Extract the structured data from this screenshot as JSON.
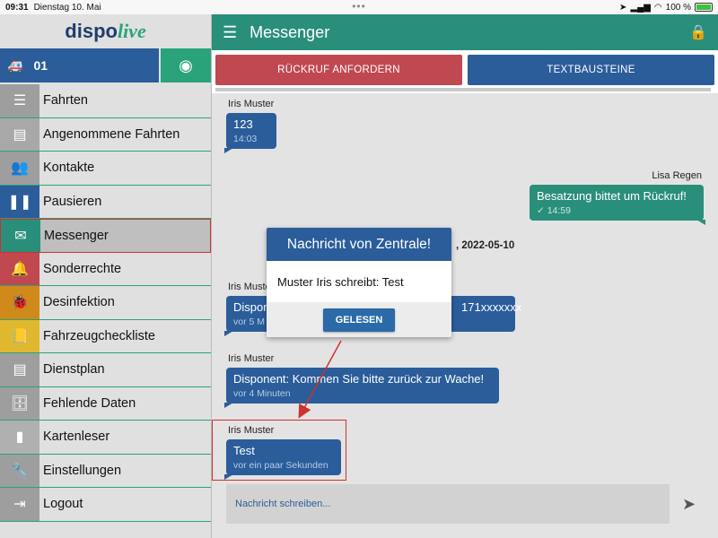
{
  "statusbar": {
    "time": "09:31",
    "date": "Dienstag 10. Mai",
    "battery": "100 %"
  },
  "sidebar": {
    "logo_a": "dispo",
    "logo_b": "live",
    "vehicle": "01",
    "items": [
      {
        "label": "Fahrten",
        "color": "#9e9e9e"
      },
      {
        "label": "Angenommene Fahrten",
        "color": "#a8a8a8"
      },
      {
        "label": "Kontakte",
        "color": "#9e9e9e"
      },
      {
        "label": "Pausieren",
        "color": "#2a5d9a"
      },
      {
        "label": "Messenger",
        "color": "#2a8f7a"
      },
      {
        "label": "Sonderrechte",
        "color": "#c04850"
      },
      {
        "label": "Desinfektion",
        "color": "#d08a1a"
      },
      {
        "label": "Fahrzeugcheckliste",
        "color": "#e0b830"
      },
      {
        "label": "Dienstplan",
        "color": "#9e9e9e"
      },
      {
        "label": "Fehlende Daten",
        "color": "#9e9e9e"
      },
      {
        "label": "Kartenleser",
        "color": "#b0b0b0"
      },
      {
        "label": "Einstellungen",
        "color": "#9e9e9e"
      },
      {
        "label": "Logout",
        "color": "#9e9e9e"
      }
    ]
  },
  "appbar": {
    "title": "Messenger"
  },
  "buttons": {
    "callback": "RÜCKRUF ANFORDERN",
    "templates": "TEXTBAUSTEINE"
  },
  "messages": [
    {
      "sender": "Iris Muster",
      "text": "123",
      "time": "14:03"
    },
    {
      "sender": "Lisa Regen",
      "text": "Besatzung bittet um Rückruf!",
      "time": "✓ 14:59"
    },
    {
      "date": ", 2022-05-10"
    },
    {
      "sender": "Iris Muster",
      "text": "Dispon",
      "text_end": "171xxxxxxx",
      "time": "vor 5 M"
    },
    {
      "sender": "Iris Muster",
      "text": "Disponent: Kommen Sie bitte zurück zur Wache!",
      "time": "vor 4 Minuten"
    },
    {
      "sender": "Iris Muster",
      "text": "Test",
      "time": "vor ein paar Sekunden"
    }
  ],
  "composer": {
    "placeholder": "Nachricht schreiben..."
  },
  "dialog": {
    "title": "Nachricht von Zentrale!",
    "body": "Muster Iris schreibt: Test",
    "button": "GELESEN"
  },
  "colors": {
    "teal": "#2a8f7a",
    "blue": "#2a5d9a",
    "red": "#c04850"
  }
}
